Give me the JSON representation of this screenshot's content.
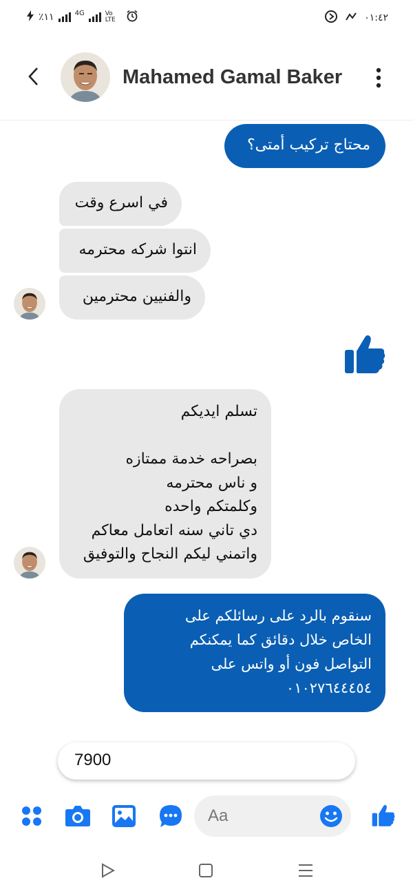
{
  "status_bar": {
    "left_text": "٪١١",
    "network": "4G",
    "volte": "Vo LTE",
    "time": "٠١:٤٢"
  },
  "header": {
    "contact_name": "Mahamed Gamal Baker"
  },
  "messages": [
    {
      "direction": "outgoing",
      "text": "محتاج تركيب أمتى؟"
    },
    {
      "direction": "incoming",
      "text": "في اسرع وقت"
    },
    {
      "direction": "incoming",
      "text": "انتوا شركه محترمه"
    },
    {
      "direction": "incoming",
      "text": "والفنيين محترمين"
    },
    {
      "direction": "outgoing",
      "type": "like-sticker"
    },
    {
      "direction": "incoming",
      "text": "تسلم ايديكم\n\nبصراحه خدمة ممتازه\nو ناس محترمه\nوكلمتكم واحده\nدي تاني سنه اتعامل معاكم\nواتمني ليكم النجاح والتوفيق"
    },
    {
      "direction": "outgoing",
      "text": "سنقوم بالرد على رسائلكم على\nالخاص خلال دقائق كما يمكنكم\nالتواصل فون أو واتس على\n٠١٠٢٧٦٤٤٤٥٤"
    }
  ],
  "suggestion": "7900",
  "composer": {
    "placeholder": "Aa"
  },
  "colors": {
    "outgoing_bubble": "#0a5fb4",
    "incoming_bubble": "#e8e8e8",
    "accent": "#1877f2"
  }
}
